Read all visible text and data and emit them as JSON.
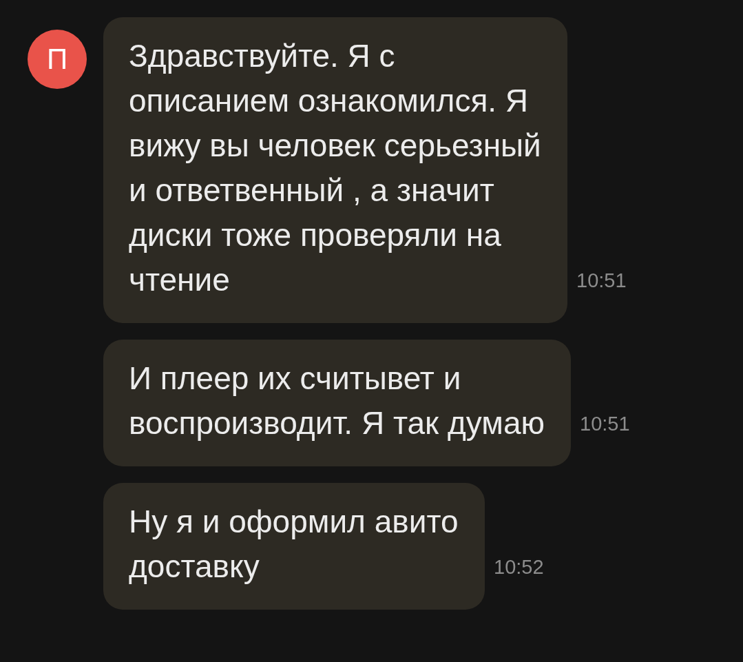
{
  "avatar": {
    "letter": "П"
  },
  "messages": [
    {
      "text": "Здравствуйте. Я с описанием ознакомился. Я вижу вы человек серьезный и ответвенный , а значит диски тоже проверяли на чтение",
      "time": "10:51"
    },
    {
      "text": "И плеер их считывет и воспроизводит. Я так думаю",
      "time": "10:51"
    },
    {
      "text": "Ну я и оформил авито доставку",
      "time": "10:52"
    }
  ]
}
